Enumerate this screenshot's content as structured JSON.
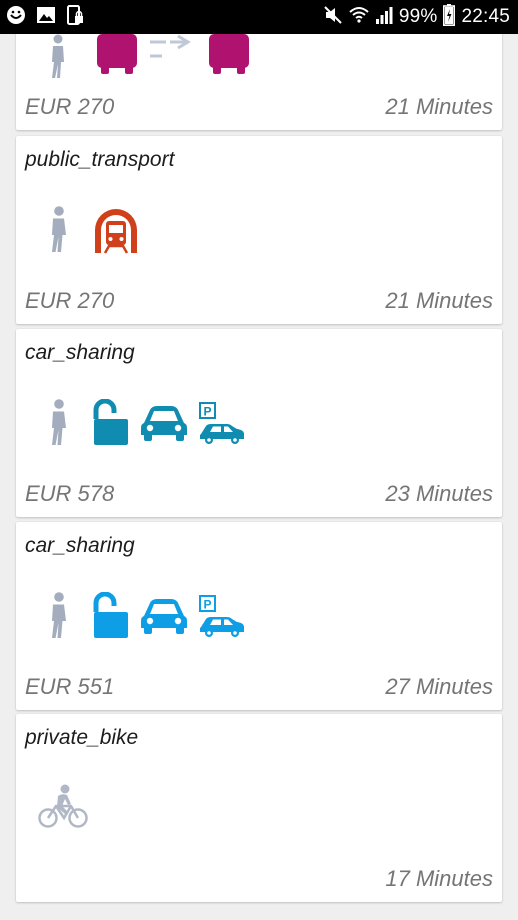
{
  "status_bar": {
    "battery": "99%",
    "time": "22:45",
    "icons": [
      "smiley-app-icon",
      "image-icon",
      "phone-lock-icon",
      "mute-icon",
      "wifi-icon",
      "signal-icon",
      "battery-charging-icon"
    ]
  },
  "colors": {
    "walk": "#a3adbd",
    "bus": "#b0126f",
    "subway": "#d0411b",
    "car_sharing_1": "#118cb1",
    "car_sharing_2": "#0d9ee6",
    "bike": "#b0b8c7"
  },
  "routes": [
    {
      "title": "",
      "price": "EUR 270",
      "duration": "21 Minutes",
      "icons": [
        "walk-icon",
        "bus-icon",
        "transfer-arrow-icon",
        "bus-icon"
      ]
    },
    {
      "title": "public_transport",
      "price": "EUR 270",
      "duration": "21 Minutes",
      "icons": [
        "walk-icon",
        "subway-icon"
      ]
    },
    {
      "title": "car_sharing",
      "price": "EUR 578",
      "duration": "23 Minutes",
      "icons": [
        "walk-icon",
        "unlock-icon",
        "car-icon",
        "parking-car-icon"
      ]
    },
    {
      "title": "car_sharing",
      "price": "EUR 551",
      "duration": "27 Minutes",
      "icons": [
        "walk-icon",
        "unlock-icon",
        "car-icon",
        "parking-car-icon"
      ]
    },
    {
      "title": "private_bike",
      "price": "",
      "duration": "17 Minutes",
      "icons": [
        "bike-icon"
      ]
    }
  ]
}
